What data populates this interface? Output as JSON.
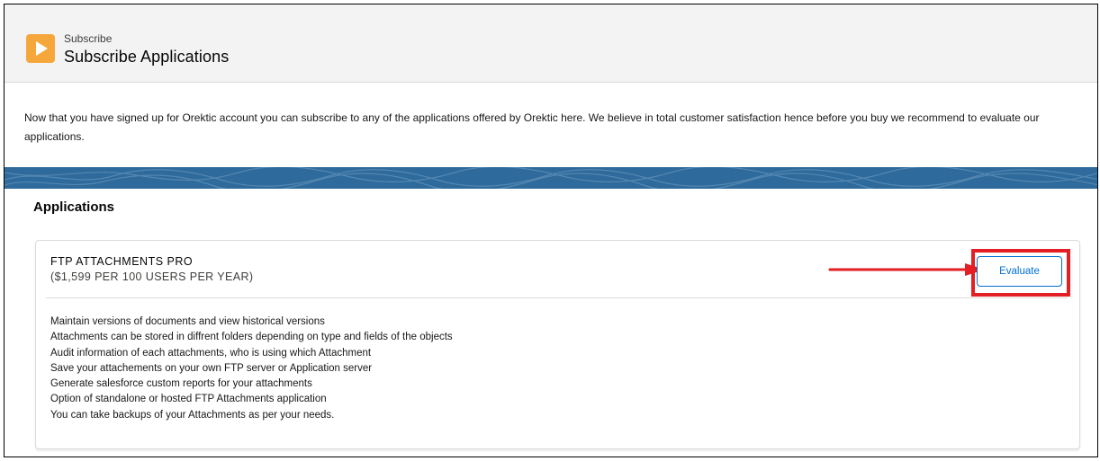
{
  "header": {
    "subtitle": "Subscribe",
    "title": "Subscribe Applications",
    "icon": "play-icon"
  },
  "intro": {
    "text": "Now that you have signed up for Orektic account you can subscribe to any of the applications offered by Orektic here. We believe in total customer satisfaction hence before you buy we  recommend to evaluate our applications."
  },
  "applications": {
    "heading": "Applications",
    "items": [
      {
        "name": "FTP ATTACHMENTS PRO",
        "price": "($1,599 PER 100 USERS PER YEAR)",
        "button_label": "Evaluate",
        "features": [
          "Maintain versions of documents and view historical versions",
          "Attachments can be stored in diffrent folders depending on type and fields of the objects",
          "Audit information of each attachments, who is using which Attachment",
          "Save your attachements on your own FTP server or Application server",
          "Generate salesforce custom reports for your attachments",
          "Option of standalone or hosted FTP Attachments application",
          "You can take backups of your Attachments as per your needs."
        ]
      }
    ]
  },
  "colors": {
    "header_icon": "#f6a73c",
    "band": "#2e6a9b",
    "button_text": "#0070d2",
    "highlight": "#e31e24"
  }
}
